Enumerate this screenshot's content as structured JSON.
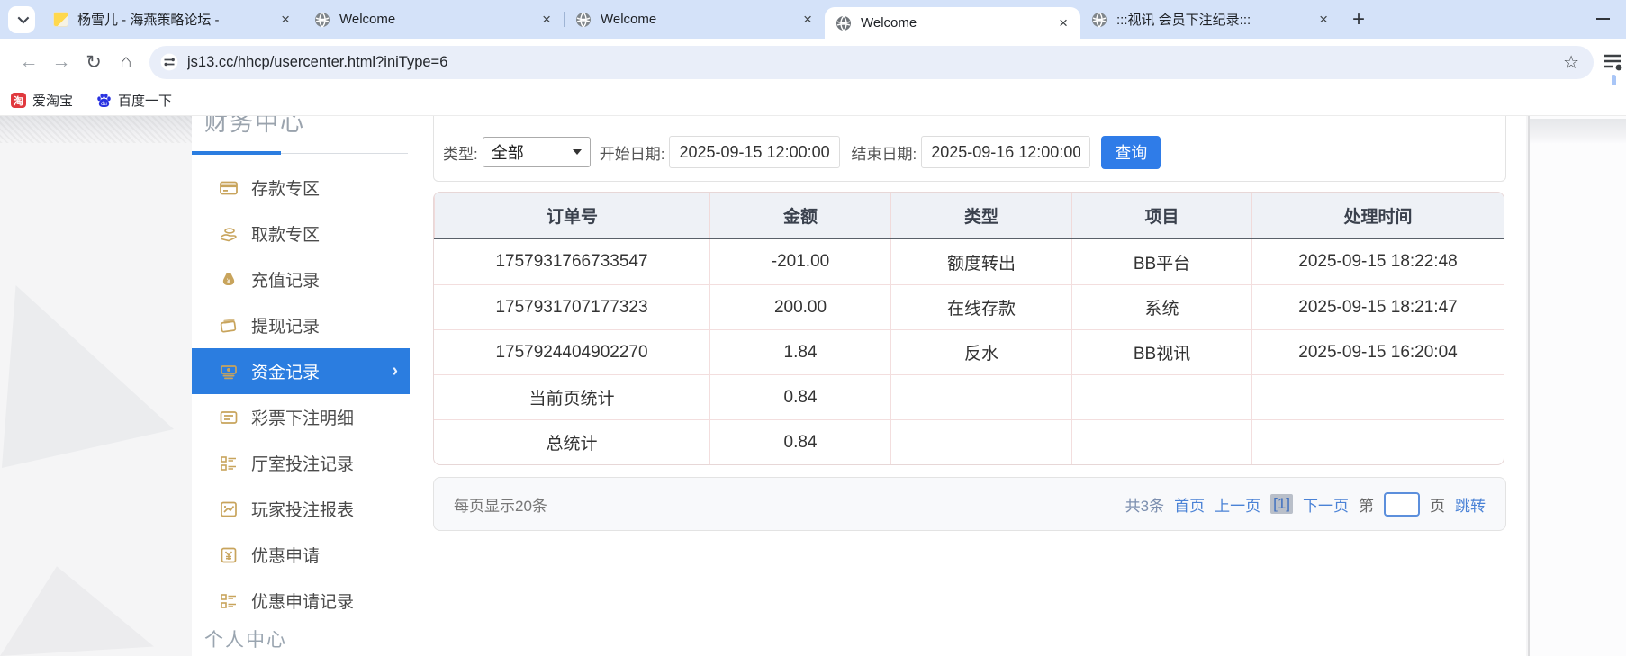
{
  "colors": {
    "accent_blue": "#2b7de0",
    "link_blue": "#4a82d6",
    "gold_icon": "#c8a45c",
    "button_blue": "#2f7ce8",
    "tabstrip_blue": "#d4e2f9"
  },
  "browser": {
    "tab_search_icon": "chevron-down-icon",
    "tabs": [
      {
        "title": "杨雪儿 - 海燕策略论坛 -",
        "icon": "yellow-page-icon",
        "close": "×",
        "active": false
      },
      {
        "title": "Welcome",
        "icon": "globe-icon",
        "close": "×",
        "active": false
      },
      {
        "title": "Welcome",
        "icon": "globe-icon",
        "close": "×",
        "active": false
      },
      {
        "title": "Welcome",
        "icon": "globe-icon",
        "close": "×",
        "active": true
      },
      {
        "title": ":::视讯 会员下注纪录:::",
        "icon": "globe-icon",
        "close": "×",
        "active": false
      }
    ],
    "new_tab_label": "+",
    "toolbar": {
      "back": "←",
      "forward": "→",
      "reload": "↻",
      "home": "⌂",
      "url": "js13.cc/hhcp/usercenter.html?iniType=6",
      "bookmark_star": "☆"
    },
    "bookmarks": [
      {
        "label": "爱淘宝",
        "icon": "taobao-icon",
        "icon_glyph": "淘"
      },
      {
        "label": "百度一下",
        "icon": "baidu-paw-icon"
      }
    ]
  },
  "page": {
    "sidebar": {
      "section_top": "财务中心",
      "items": [
        {
          "label": "存款专区",
          "icon": "bank-card-icon"
        },
        {
          "label": "取款专区",
          "icon": "hand-money-icon"
        },
        {
          "label": "充值记录",
          "icon": "money-bag-icon"
        },
        {
          "label": "提现记录",
          "icon": "wallet-icon"
        },
        {
          "label": "资金记录",
          "icon": "banknotes-icon",
          "active": true,
          "arrow": "›"
        },
        {
          "label": "彩票下注明细",
          "icon": "list-icon"
        },
        {
          "label": "厅室投注记录",
          "icon": "list-detail-icon"
        },
        {
          "label": "玩家投注报表",
          "icon": "chart-report-icon"
        },
        {
          "label": "优惠申请",
          "icon": "coupon-icon"
        },
        {
          "label": "优惠申请记录",
          "icon": "list-detail-icon"
        }
      ],
      "section_bottom": "个人中心"
    },
    "filters": {
      "type_label": "类型:",
      "type_value": "全部",
      "start_label": "开始日期:",
      "start_value": "2025-09-15 12:00:00",
      "end_label": "结束日期:",
      "end_value": "2025-09-16 12:00:00",
      "search_label": "查询"
    },
    "table": {
      "headers": [
        "订单号",
        "金额",
        "类型",
        "项目",
        "处理时间"
      ],
      "rows": [
        [
          "1757931766733547",
          "-201.00",
          "额度转出",
          "BB平台",
          "2025-09-15 18:22:48"
        ],
        [
          "1757931707177323",
          "200.00",
          "在线存款",
          "系统",
          "2025-09-15 18:21:47"
        ],
        [
          "1757924404902270",
          "1.84",
          "反水",
          "BB视讯",
          "2025-09-15 16:20:04"
        ],
        [
          "当前页统计",
          "0.84",
          "",
          "",
          ""
        ],
        [
          "总统计",
          "0.84",
          "",
          "",
          ""
        ]
      ]
    },
    "pagination": {
      "page_size_text": "每页显示20条",
      "total_text": "共3条",
      "first": "首页",
      "prev": "上一页",
      "current": "[1]",
      "next": "下一页",
      "jump_pre": "第",
      "jump_value": "",
      "jump_post": "页",
      "jump_button": "跳转"
    }
  }
}
